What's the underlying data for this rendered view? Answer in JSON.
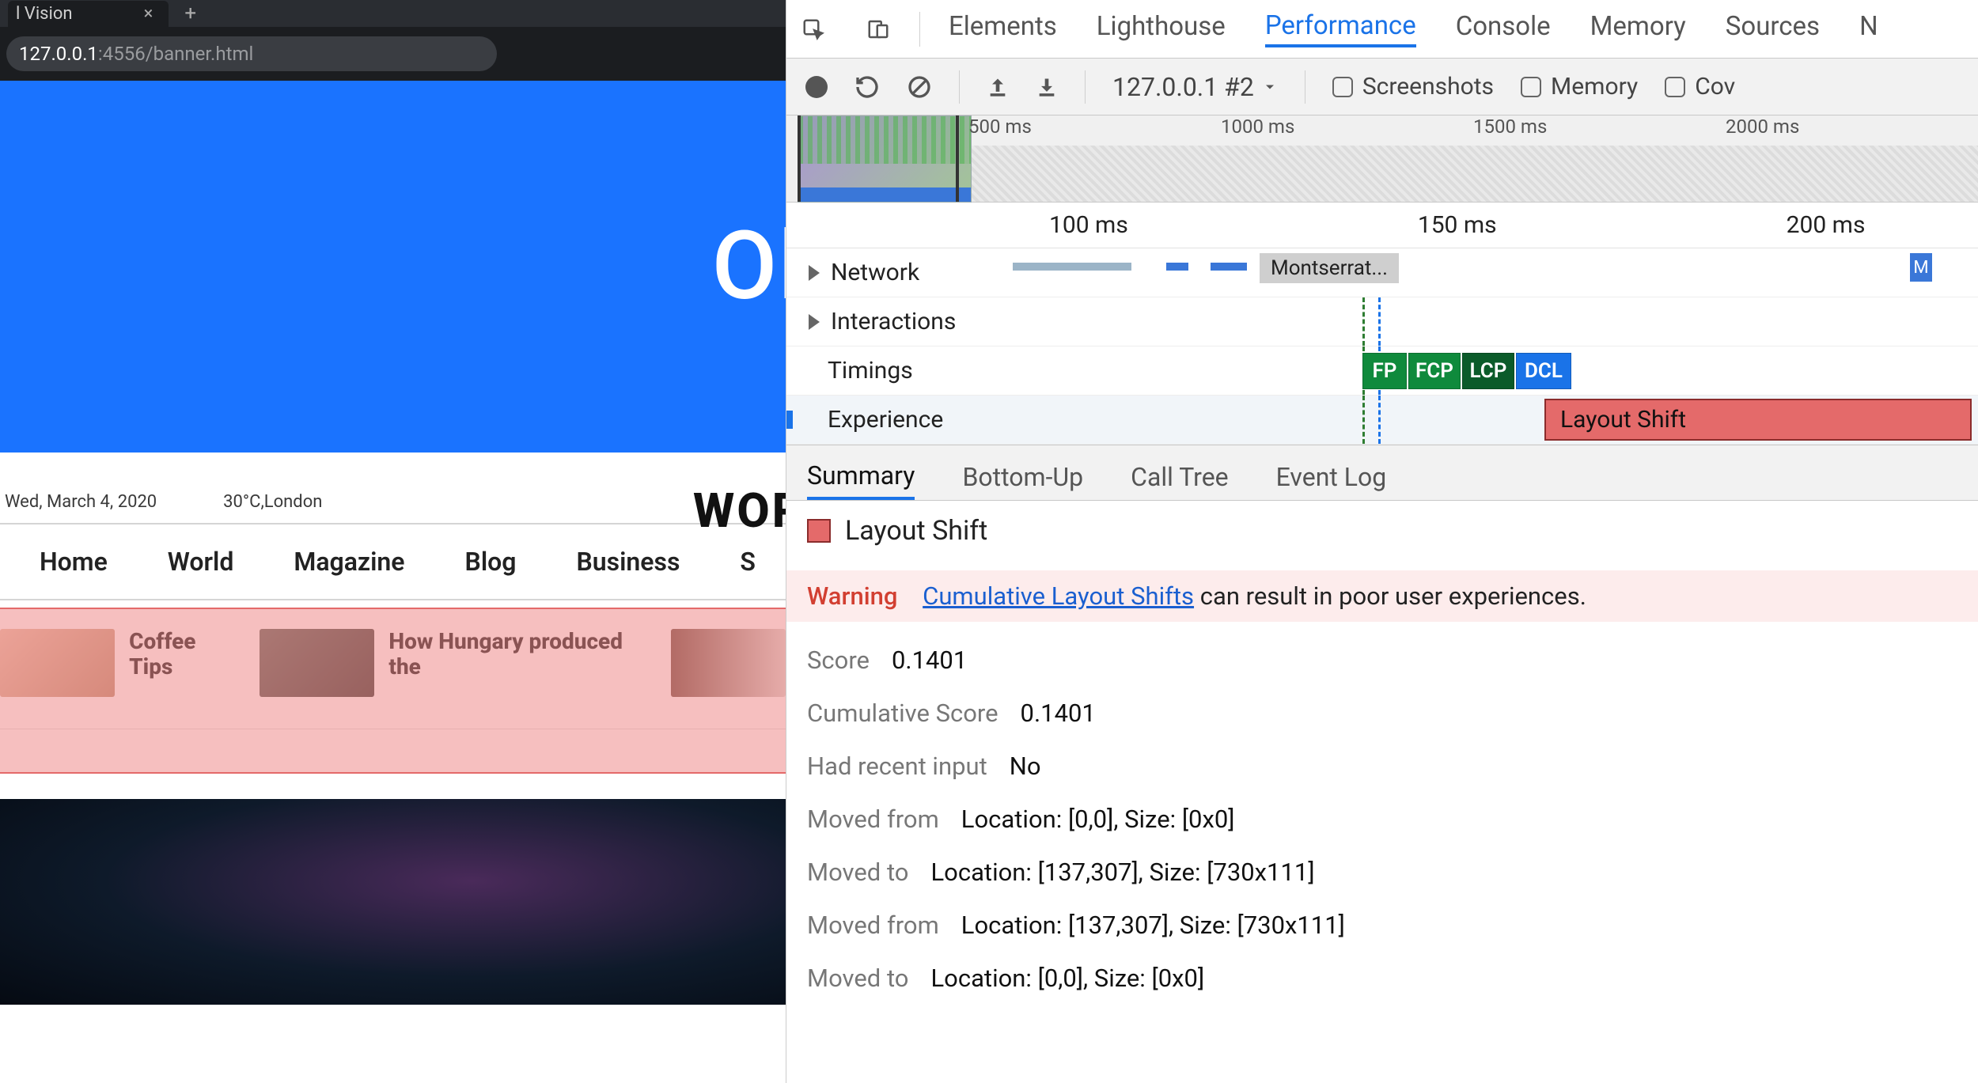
{
  "browser": {
    "tab_title": "l Vision",
    "address_host": "127.0.0.1",
    "address_path": ":4556/banner.html"
  },
  "page": {
    "banner_text": "Oh",
    "date": "Wed, March 4, 2020",
    "weather": "30°C,London",
    "site_title": "WORL",
    "nav": [
      "Home",
      "World",
      "Magazine",
      "Blog",
      "Business",
      "S"
    ],
    "stories": [
      {
        "title": "Coffee Tips"
      },
      {
        "title": "How Hungary produced the"
      }
    ]
  },
  "devtools": {
    "tabs": [
      "Elements",
      "Lighthouse",
      "Performance",
      "Console",
      "Memory",
      "Sources",
      "N"
    ],
    "active_tab": "Performance",
    "toolbar": {
      "profile_label": "127.0.0.1 #2",
      "checks": [
        "Screenshots",
        "Memory",
        "Cov"
      ]
    },
    "overview_ticks": [
      "500 ms",
      "1000 ms",
      "1500 ms",
      "2000 ms"
    ],
    "flame": {
      "ruler_ticks": [
        "100 ms",
        "150 ms",
        "200 ms"
      ],
      "tracks": {
        "network": "Network",
        "interactions": "Interactions",
        "timings": "Timings",
        "experience": "Experience"
      },
      "net_resource": "Montserrat...",
      "net_m": "M",
      "timing_markers": [
        "FP",
        "FCP",
        "LCP",
        "DCL"
      ],
      "layout_shift_bar": "Layout Shift"
    },
    "detail_tabs": [
      "Summary",
      "Bottom-Up",
      "Call Tree",
      "Event Log"
    ],
    "active_detail_tab": "Summary",
    "details": {
      "heading": "Layout Shift",
      "warning_label": "Warning",
      "warning_link": "Cumulative Layout Shifts",
      "warning_tail": " can result in poor user experiences.",
      "rows": [
        {
          "k": "Score",
          "v": "0.1401"
        },
        {
          "k": "Cumulative Score",
          "v": "0.1401"
        },
        {
          "k": "Had recent input",
          "v": "No"
        },
        {
          "k": "Moved from",
          "v": "Location: [0,0], Size: [0x0]"
        },
        {
          "k": "Moved to",
          "v": "Location: [137,307], Size: [730x111]"
        },
        {
          "k": "Moved from",
          "v": "Location: [137,307], Size: [730x111]"
        },
        {
          "k": "Moved to",
          "v": "Location: [0,0], Size: [0x0]"
        }
      ]
    }
  }
}
